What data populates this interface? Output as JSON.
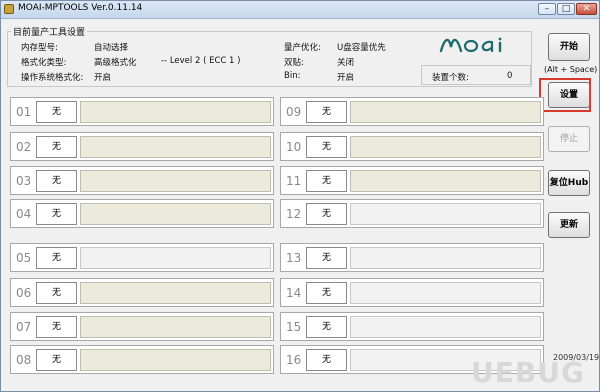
{
  "window": {
    "title": "MOAI-MPTOOLS Ver.0.11.14"
  },
  "settings": {
    "group_title": "目前量产工具设置",
    "rows": [
      {
        "label": "内存型号:",
        "value": "自动选择"
      },
      {
        "label": "格式化类型:",
        "value": "高级格式化",
        "extra": "-- Level 2 ( ECC 1 )"
      },
      {
        "label": "操作系统格式化:",
        "value": "开启"
      }
    ],
    "right_rows": [
      {
        "label": "量产优化:",
        "value": "U盘容量优先"
      },
      {
        "label": "双贴:",
        "value": "关闭"
      },
      {
        "label": "Bin:",
        "value": "开启"
      }
    ]
  },
  "logo_text": "moai",
  "device_count": {
    "label": "装置个数:",
    "value": "0"
  },
  "actions": {
    "start": "开始",
    "shortcut": "(Alt + Space)",
    "settings": "设置",
    "stop": "停止",
    "reset_hub": "复位Hub",
    "refresh": "更新"
  },
  "ports": [
    {
      "num": "01",
      "status": "无",
      "info": ""
    },
    {
      "num": "02",
      "status": "无",
      "info": ""
    },
    {
      "num": "03",
      "status": "无",
      "info": ""
    },
    {
      "num": "04",
      "status": "无",
      "info": ""
    },
    {
      "num": "05",
      "status": "无",
      "info": ""
    },
    {
      "num": "06",
      "status": "无",
      "info": ""
    },
    {
      "num": "07",
      "status": "无",
      "info": ""
    },
    {
      "num": "08",
      "status": "无",
      "info": ""
    },
    {
      "num": "09",
      "status": "无",
      "info": ""
    },
    {
      "num": "10",
      "status": "无",
      "info": ""
    },
    {
      "num": "11",
      "status": "无",
      "info": ""
    },
    {
      "num": "12",
      "status": "无",
      "info": ""
    },
    {
      "num": "13",
      "status": "无",
      "info": ""
    },
    {
      "num": "14",
      "status": "无",
      "info": ""
    },
    {
      "num": "15",
      "status": "无",
      "info": ""
    },
    {
      "num": "16",
      "status": "无",
      "info": ""
    }
  ],
  "date_text": "2009/03/19",
  "watermark": "UEBUG",
  "colors": {
    "accent_highlight": "#d63a2e",
    "port_info_bg": "#ebeadb",
    "logo": "#1f6a6e"
  }
}
